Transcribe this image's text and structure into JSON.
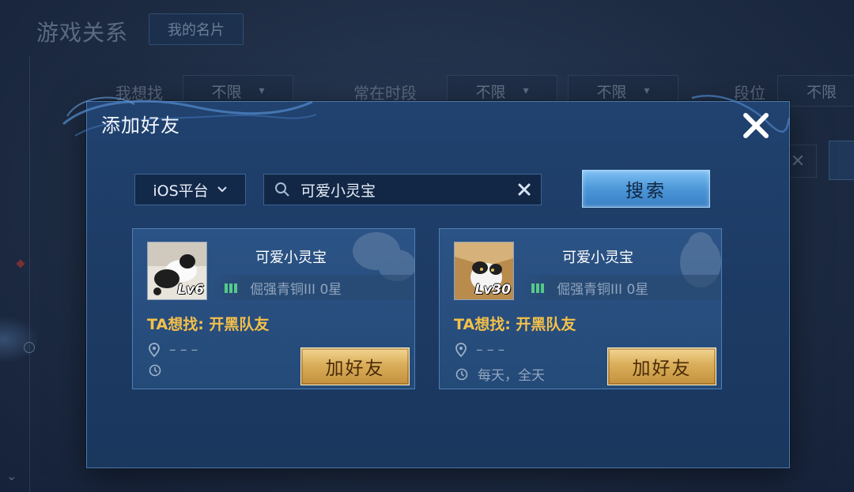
{
  "background": {
    "title": "游戏关系",
    "my_card_button": "我的名片",
    "filters": [
      {
        "label": "我想找",
        "value": "不限"
      },
      {
        "label": "常在时段",
        "value": "不限"
      },
      {
        "label": "",
        "value": "不限"
      },
      {
        "label": "段位",
        "value": "不限"
      }
    ]
  },
  "modal": {
    "title": "添加好友",
    "platform": "iOS平台",
    "search_value": "可爱小灵宝",
    "search_button": "搜索"
  },
  "results": [
    {
      "name": "可爱小灵宝",
      "level": "Lv6",
      "rank": "倔强青铜III 0星",
      "want": "TA想找: 开黑队友",
      "location": "– – –",
      "time": "",
      "add_label": "加好友",
      "deco_icon": "chat-bubble-icon",
      "avatar_bg": "#d9d5cc"
    },
    {
      "name": "可爱小灵宝",
      "level": "Lv30",
      "rank": "倔强青铜III 0星",
      "want": "TA想找: 开黑队友",
      "location": "– – –",
      "time": "每天，全天",
      "add_label": "加好友",
      "deco_icon": "penguin-icon",
      "avatar_bg": "#c8a36a"
    }
  ],
  "colors": {
    "accent_gold": "#f5c04a",
    "search_button": "#4c97d8",
    "add_button": "#d9ae5a"
  }
}
